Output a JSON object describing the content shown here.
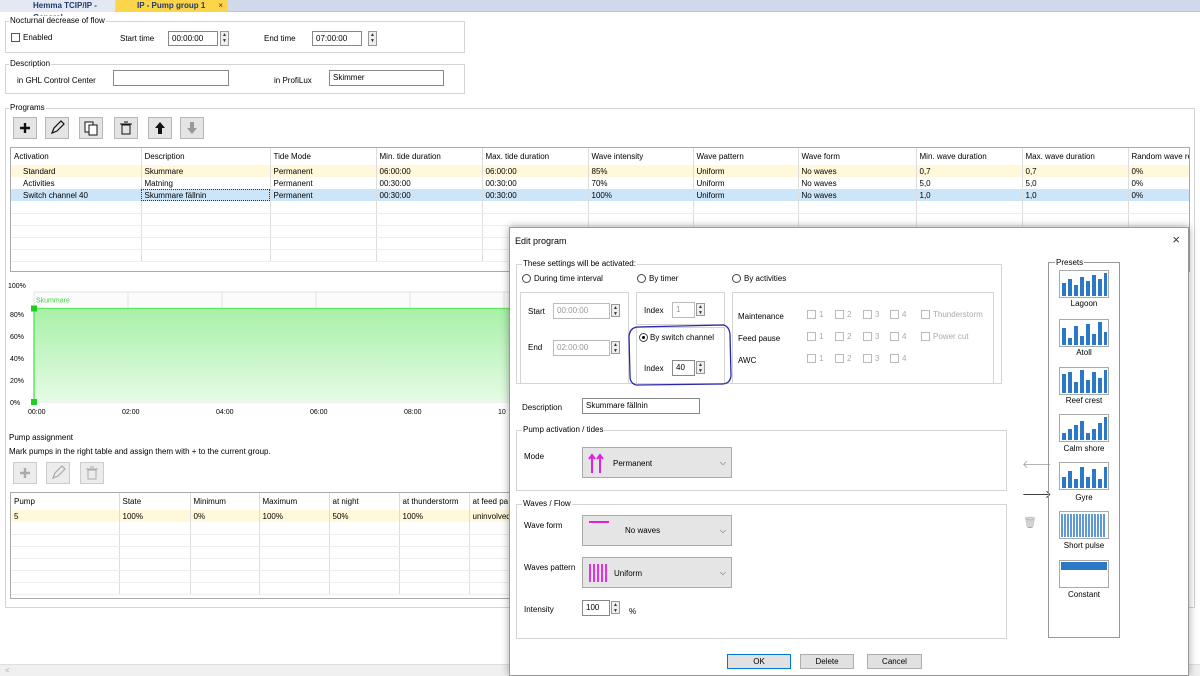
{
  "tabs": [
    {
      "label": "Hemma TCIP/IP - General"
    },
    {
      "label": "IP - Pump group 1"
    }
  ],
  "tab_close": "×",
  "nocturnal": {
    "title": "Nocturnal decrease of flow",
    "enabled_label": "Enabled",
    "start_label": "Start time",
    "start_value": "00:00:00",
    "end_label": "End time",
    "end_value": "07:00:00"
  },
  "description_group": {
    "title": "Description",
    "ghl_label": "in GHL Control Center",
    "ghl_value": "",
    "profilux_label": "in ProfiLux",
    "profilux_value": "Skimmer"
  },
  "programs": {
    "title": "Programs",
    "columns": [
      "Activation",
      "Description",
      "Tide Mode",
      "Min. tide duration",
      "Max. tide duration",
      "Wave intensity",
      "Wave pattern",
      "Wave form",
      "Min. wave duration",
      "Max. wave duration",
      "Random wave re"
    ],
    "rows": [
      [
        "Standard",
        "Skummare",
        "Permanent",
        "06:00:00",
        "06:00:00",
        "85%",
        "Uniform",
        "No waves",
        "0,7",
        "0,7",
        "0%"
      ],
      [
        "Activities",
        "Matning",
        "Permanent",
        "00:30:00",
        "00:30:00",
        "70%",
        "Uniform",
        "No waves",
        "5,0",
        "5,0",
        "0%"
      ],
      [
        "Switch channel 40",
        "Skummare fällnin",
        "Permanent",
        "00:30:00",
        "00:30:00",
        "100%",
        "Uniform",
        "No waves",
        "1,0",
        "1,0",
        "0%"
      ]
    ]
  },
  "chart_data": {
    "type": "area",
    "series": [
      {
        "name": "Skummare",
        "values": [
          85,
          85
        ]
      }
    ],
    "x": [
      "00:00",
      "24:00"
    ],
    "y_ticks": [
      "100%",
      "80%",
      "60%",
      "40%",
      "20%",
      "0%"
    ],
    "x_ticks": [
      "00:00",
      "02:00",
      "04:00",
      "06:00",
      "08:00",
      "10"
    ],
    "ylim": [
      0,
      100
    ],
    "color": "#5ee85e"
  },
  "pump_assignment": {
    "title": "Pump assignment",
    "hint": "Mark pumps in the right table and assign them with + to the current group.",
    "columns": [
      "Pump",
      "State",
      "Minimum",
      "Maximum",
      "at night",
      "at thunderstorm",
      "at feed pa"
    ],
    "rows": [
      [
        "5",
        "100%",
        "0%",
        "100%",
        "50%",
        "100%",
        "uninvolved"
      ]
    ]
  },
  "dialog": {
    "title": "Edit program",
    "close": "×",
    "activation_title": "These settings will be activated:",
    "opt_time": "During time interval",
    "opt_timer": "By timer",
    "opt_activities": "By activities",
    "start_label": "Start",
    "start_value": "00:00:00",
    "end_label": "End",
    "end_value": "02:00:00",
    "index_label": "Index",
    "timer_index": "1",
    "opt_switch": "By switch channel",
    "switch_index": "40",
    "maintenance": "Maintenance",
    "feed_pause": "Feed pause",
    "awc": "AWC",
    "nums": [
      "1",
      "2",
      "3",
      "4"
    ],
    "thunderstorm": "Thunderstorm",
    "power_cut": "Power cut",
    "description_label": "Description",
    "description_value": "Skummare fällnin",
    "pump_group_title": "Pump activation / tides",
    "mode_label": "Mode",
    "mode_value": "Permanent",
    "waves_title": "Waves / Flow",
    "wave_form_label": "Wave form",
    "wave_form_value": "No waves",
    "pattern_label": "Waves pattern",
    "pattern_value": "Uniform",
    "intensity_label": "Intensity",
    "intensity_value": "100",
    "intensity_unit": "%",
    "presets_title": "Presets",
    "presets": [
      "Lagoon",
      "Atoll",
      "Reef crest",
      "Calm shore",
      "Gyre",
      "Short pulse",
      "Constant"
    ],
    "ok": "OK",
    "delete": "Delete",
    "cancel": "Cancel",
    "accent": "#e020e0",
    "highlight": "#2a2aa8"
  }
}
